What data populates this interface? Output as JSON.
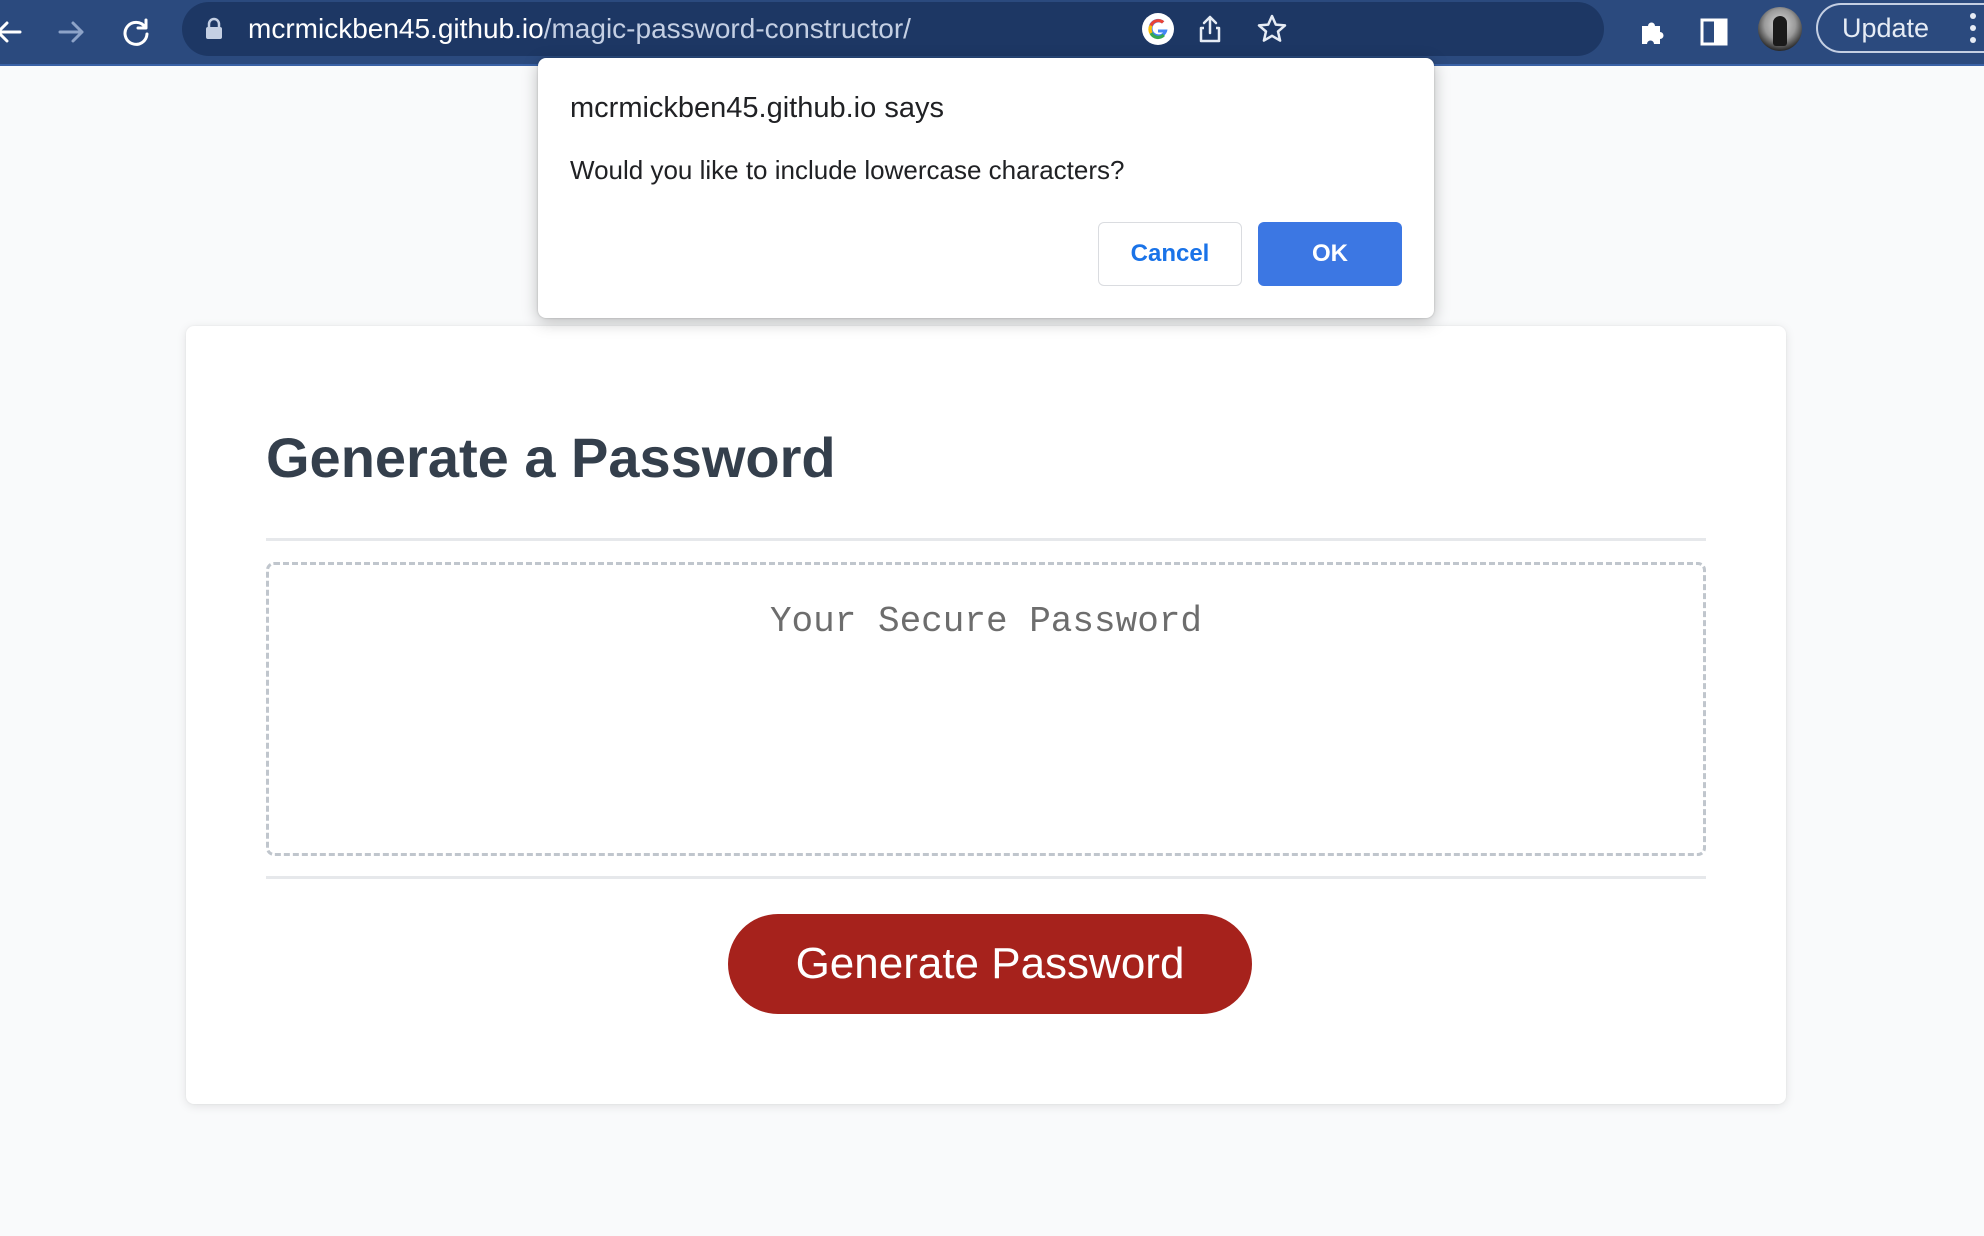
{
  "browser": {
    "url_host": "mcrmickben45.github.io",
    "url_path": "/magic-password-constructor/",
    "update_label": "Update",
    "icons": {
      "back": "arrow-left-icon",
      "forward": "arrow-right-icon",
      "reload": "reload-icon",
      "lock": "lock-icon",
      "google": "google-icon",
      "share": "share-icon",
      "bookmark": "star-icon",
      "extensions": "puzzle-icon",
      "side_panel": "side-panel-icon",
      "menu": "kebab-menu-icon"
    }
  },
  "dialog": {
    "title": "mcrmickben45.github.io says",
    "message": "Would you like to include lowercase characters?",
    "cancel_label": "Cancel",
    "ok_label": "OK"
  },
  "card": {
    "title": "Generate a Password",
    "password_placeholder": "Your Secure Password",
    "generate_label": "Generate Password"
  },
  "colors": {
    "toolbar": "#2b4a7e",
    "omnibox": "#1d3764",
    "accent_button": "#a6221c",
    "dialog_ok": "#3c77e3",
    "page_background": "#f9fafb"
  }
}
